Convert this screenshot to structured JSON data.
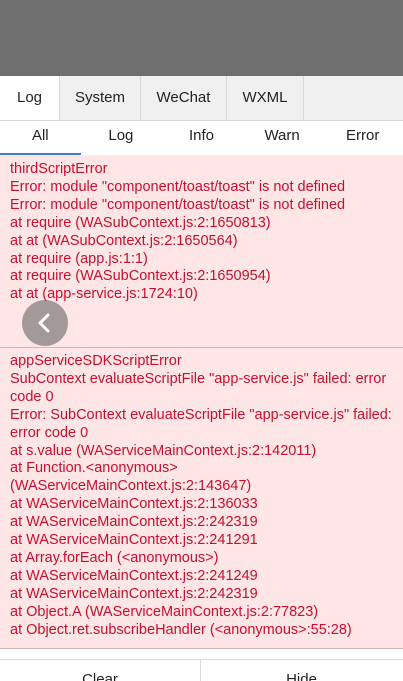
{
  "main_tabs": [
    "Log",
    "System",
    "WeChat",
    "WXML"
  ],
  "sub_tabs": [
    "All",
    "Log",
    "Info",
    "Warn",
    "Error"
  ],
  "entries": [
    [
      "thirdScriptError",
      "Error: module \"component/toast/toast\" is not defined",
      "Error: module \"component/toast/toast\" is not defined",
      "at require (WASubContext.js:2:1650813)",
      "at at (WASubContext.js:2:1650564)",
      "at require (app.js:1:1)",
      "at require (WASubContext.js:2:1650954)",
      "at at (app-service.js:1724:10)"
    ],
    [
      "appServiceSDKScriptError",
      "SubContext evaluateScriptFile \"app-service.js\" failed: error code 0",
      "Error: SubContext evaluateScriptFile \"app-service.js\" failed: error code 0",
      "at s.value (WAServiceMainContext.js:2:142011)",
      "at Function.<anonymous> (WAServiceMainContext.js:2:143647)",
      "at WAServiceMainContext.js:2:136033",
      "at WAServiceMainContext.js:2:242319",
      "at WAServiceMainContext.js:2:241291",
      "at Array.forEach (<anonymous>)",
      "at WAServiceMainContext.js:2:241249",
      "at WAServiceMainContext.js:2:242319",
      "at Object.A (WAServiceMainContext.js:2:77823)",
      "at Object.ret.subscribeHandler (<anonymous>:55:28)"
    ]
  ],
  "bottom_bar": {
    "clear_label": "Clear",
    "hide_label": "Hide"
  },
  "colors": {
    "error_bg": "#ffe6e6",
    "error_text": "#c8102e",
    "active_tab_underline": "#3b7fd6"
  },
  "icons": {
    "float_button": "back-arrow-icon"
  }
}
